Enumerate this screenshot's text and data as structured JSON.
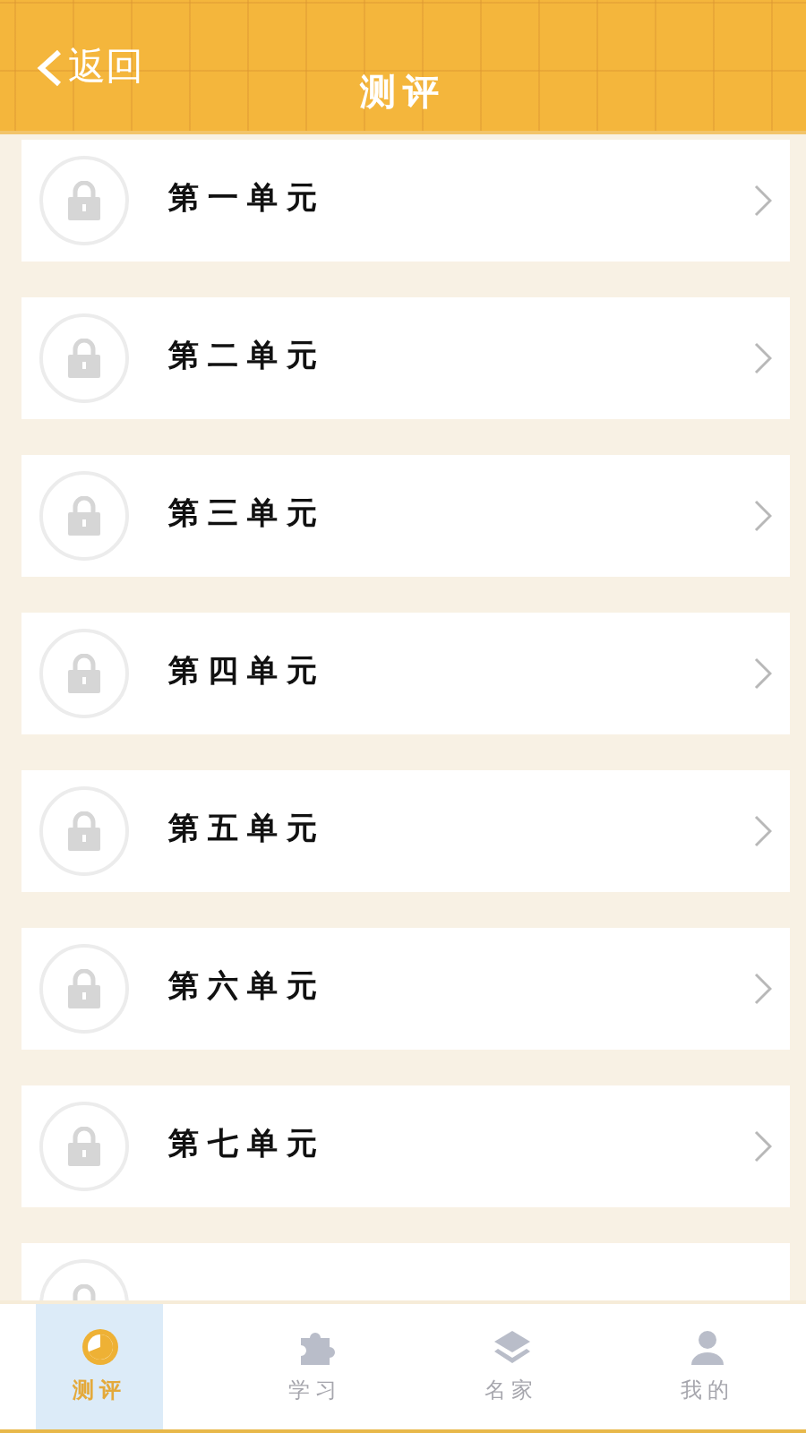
{
  "header": {
    "back": "返回",
    "title": "测评"
  },
  "units": [
    {
      "label": "第一单元",
      "locked": true
    },
    {
      "label": "第二单元",
      "locked": true
    },
    {
      "label": "第三单元",
      "locked": true
    },
    {
      "label": "第四单元",
      "locked": true
    },
    {
      "label": "第五单元",
      "locked": true
    },
    {
      "label": "第六单元",
      "locked": true
    },
    {
      "label": "第七单元",
      "locked": true
    },
    {
      "locked": true
    }
  ],
  "tabs": [
    {
      "label": "测评",
      "kind": "clock",
      "selected": true
    },
    {
      "label": "学习",
      "kind": "puzzle",
      "selected": false
    },
    {
      "label": "名家",
      "kind": "layers",
      "selected": false
    },
    {
      "label": "我的",
      "kind": "person",
      "selected": false
    }
  ]
}
